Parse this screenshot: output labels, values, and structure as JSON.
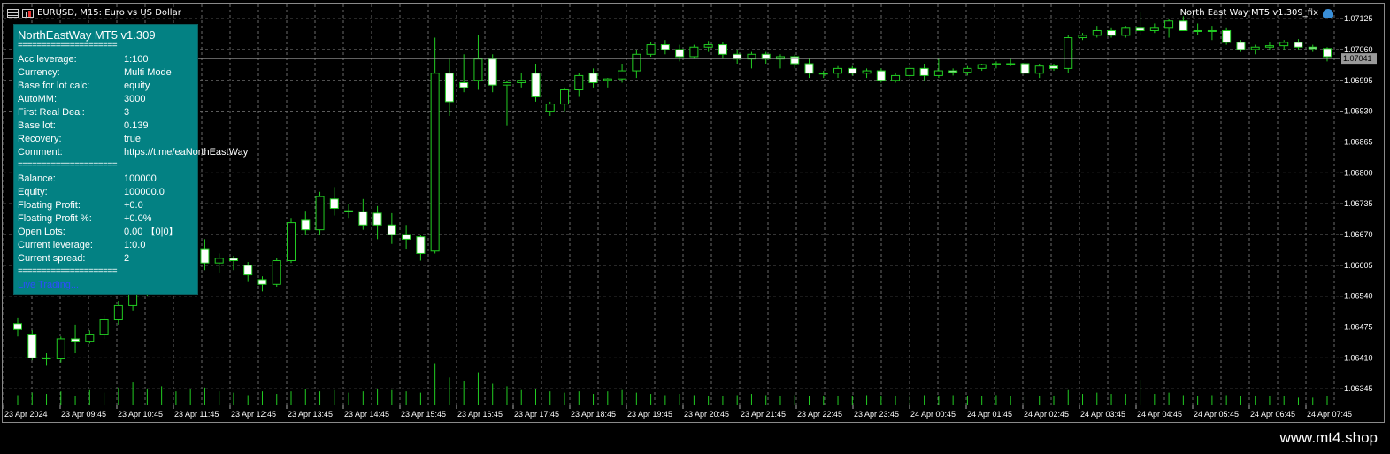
{
  "window": {
    "symbol_title": "EURUSD, M15:  Euro vs US Dollar",
    "ea_title": "North East Way MT5 v1.309_fix"
  },
  "panel": {
    "title": "NorthEastWay MT5 v1.309",
    "separator": "=====================",
    "rows_top": [
      {
        "label": "Acc leverage:",
        "value": "1:100"
      },
      {
        "label": "Currency:",
        "value": "Multi Mode"
      },
      {
        "label": "Base for lot calc:",
        "value": "equity"
      },
      {
        "label": "AutoMM:",
        "value": "3000"
      },
      {
        "label": "First Real Deal:",
        "value": "3"
      },
      {
        "label": "Base lot:",
        "value": "0.139"
      },
      {
        "label": "Recovery:",
        "value": "true"
      },
      {
        "label": "Comment:",
        "value": "https://t.me/eaNorthEastWay"
      }
    ],
    "rows_bottom": [
      {
        "label": "Balance:",
        "value": "100000"
      },
      {
        "label": "Equity:",
        "value": "100000.0"
      },
      {
        "label": "Floating Profit:",
        "value": "+0.0"
      },
      {
        "label": "Floating Profit %:",
        "value": "+0.0%"
      },
      {
        "label": "Open Lots:",
        "value": "0.00 【0|0】"
      },
      {
        "label": "Current leverage:",
        "value": "1:0.0"
      },
      {
        "label": "Current spread:",
        "value": "2"
      }
    ],
    "link": "Live Trading..."
  },
  "price_axis": [
    "1.07125",
    "1.06995",
    "1.06930",
    "1.06865",
    "1.06800",
    "1.06735",
    "1.06670",
    "1.06605",
    "1.06540",
    "1.06475",
    "1.06410",
    "1.06345"
  ],
  "price_axis_top": "1.07060",
  "current_price": "1.07041",
  "time_axis": [
    "23 Apr 2024",
    "23 Apr 09:45",
    "23 Apr 10:45",
    "23 Apr 11:45",
    "23 Apr 12:45",
    "23 Apr 13:45",
    "23 Apr 14:45",
    "23 Apr 15:45",
    "23 Apr 16:45",
    "23 Apr 17:45",
    "23 Apr 18:45",
    "23 Apr 19:45",
    "23 Apr 20:45",
    "23 Apr 21:45",
    "23 Apr 22:45",
    "23 Apr 23:45",
    "24 Apr 00:45",
    "24 Apr 01:45",
    "24 Apr 02:45",
    "24 Apr 03:45",
    "24 Apr 04:45",
    "24 Apr 05:45",
    "24 Apr 06:45",
    "24 Apr 07:45"
  ],
  "watermark": "www.mt4.shop",
  "colors": {
    "bull": "#000000",
    "bear": "#ffffff",
    "wick": "#22cc22",
    "grid": "#6a6a6a",
    "panel": "#038183",
    "volume": "#22cc22"
  },
  "chart_data": {
    "type": "candlestick",
    "ylim": [
      1.0631,
      1.07155
    ],
    "candles": [
      [
        1.06482,
        1.06495,
        1.06455,
        1.0647
      ],
      [
        1.0646,
        1.06468,
        1.06405,
        1.0641
      ],
      [
        1.0641,
        1.0642,
        1.06395,
        1.06408
      ],
      [
        1.06408,
        1.06455,
        1.064,
        1.0645
      ],
      [
        1.0645,
        1.0648,
        1.0642,
        1.06445
      ],
      [
        1.06445,
        1.06468,
        1.0644,
        1.0646
      ],
      [
        1.0646,
        1.065,
        1.0645,
        1.0649
      ],
      [
        1.0649,
        1.0653,
        1.0648,
        1.0652
      ],
      [
        1.0652,
        1.0656,
        1.0651,
        1.06548
      ],
      [
        1.06548,
        1.0659,
        1.0654,
        1.0658
      ],
      [
        1.0658,
        1.0662,
        1.0657,
        1.0661
      ],
      [
        1.0661,
        1.0664,
        1.066,
        1.06625
      ],
      [
        1.06625,
        1.0665,
        1.0661,
        1.0664
      ],
      [
        1.0664,
        1.0666,
        1.06595,
        1.0661
      ],
      [
        1.0661,
        1.0663,
        1.0659,
        1.0662
      ],
      [
        1.0662,
        1.06625,
        1.06595,
        1.06615
      ],
      [
        1.06605,
        1.06612,
        1.0657,
        1.06585
      ],
      [
        1.06575,
        1.06582,
        1.0655,
        1.06565
      ],
      [
        1.06565,
        1.0662,
        1.0656,
        1.06615
      ],
      [
        1.06615,
        1.06705,
        1.0661,
        1.06695
      ],
      [
        1.067,
        1.0672,
        1.0667,
        1.0668
      ],
      [
        1.0668,
        1.0676,
        1.0667,
        1.0675
      ],
      [
        1.06745,
        1.0677,
        1.0671,
        1.06725
      ],
      [
        1.0672,
        1.06735,
        1.06705,
        1.06718
      ],
      [
        1.06718,
        1.06745,
        1.0668,
        1.0669
      ],
      [
        1.06715,
        1.0673,
        1.0666,
        1.0669
      ],
      [
        1.0669,
        1.06715,
        1.0665,
        1.0667
      ],
      [
        1.0667,
        1.0669,
        1.0664,
        1.0666
      ],
      [
        1.06665,
        1.0667,
        1.06615,
        1.0663
      ],
      [
        1.06635,
        1.07085,
        1.0663,
        1.0701
      ],
      [
        1.0701,
        1.0704,
        1.0692,
        1.0695
      ],
      [
        1.0699,
        1.0705,
        1.0697,
        1.0698
      ],
      [
        1.06995,
        1.0709,
        1.06975,
        1.0704
      ],
      [
        1.0704,
        1.0705,
        1.0697,
        1.06985
      ],
      [
        1.06985,
        1.06995,
        1.069,
        1.0699
      ],
      [
        1.0699,
        1.0701,
        1.0698,
        1.06995
      ],
      [
        1.0701,
        1.0703,
        1.0695,
        1.0696
      ],
      [
        1.0693,
        1.0695,
        1.0692,
        1.06945
      ],
      [
        1.06945,
        1.0698,
        1.0693,
        1.06975
      ],
      [
        1.06975,
        1.0701,
        1.0696,
        1.07005
      ],
      [
        1.0701,
        1.0702,
        1.0698,
        1.0699
      ],
      [
        1.06995,
        1.07,
        1.0698,
        1.06998
      ],
      [
        1.06998,
        1.0703,
        1.0699,
        1.07015
      ],
      [
        1.07015,
        1.0706,
        1.07,
        1.0705
      ],
      [
        1.0705,
        1.07075,
        1.07045,
        1.0707
      ],
      [
        1.0707,
        1.0708,
        1.0705,
        1.0706
      ],
      [
        1.0706,
        1.0707,
        1.07035,
        1.07045
      ],
      [
        1.07045,
        1.0707,
        1.0704,
        1.07065
      ],
      [
        1.07065,
        1.07078,
        1.07055,
        1.0707
      ],
      [
        1.0707,
        1.07075,
        1.0704,
        1.0705
      ],
      [
        1.0705,
        1.0706,
        1.0703,
        1.0704
      ],
      [
        1.0704,
        1.07055,
        1.0702,
        1.0705
      ],
      [
        1.0705,
        1.07055,
        1.0703,
        1.0704
      ],
      [
        1.0704,
        1.0705,
        1.0702,
        1.07045
      ],
      [
        1.07045,
        1.0705,
        1.0702,
        1.0703
      ],
      [
        1.0703,
        1.0704,
        1.07,
        1.0701
      ],
      [
        1.0701,
        1.07015,
        1.07,
        1.0701
      ],
      [
        1.0701,
        1.07025,
        1.07,
        1.0702
      ],
      [
        1.0702,
        1.07025,
        1.07005,
        1.0701
      ],
      [
        1.0701,
        1.0702,
        1.07,
        1.07015
      ],
      [
        1.07015,
        1.0702,
        1.0699,
        1.06995
      ],
      [
        1.06995,
        1.0701,
        1.0699,
        1.07005
      ],
      [
        1.07005,
        1.07025,
        1.07,
        1.0702
      ],
      [
        1.0702,
        1.0703,
        1.06995,
        1.07005
      ],
      [
        1.07005,
        1.0704,
        1.07,
        1.07015
      ],
      [
        1.07015,
        1.0702,
        1.07005,
        1.07012
      ],
      [
        1.07012,
        1.07025,
        1.07005,
        1.0702
      ],
      [
        1.0702,
        1.0703,
        1.07015,
        1.07028
      ],
      [
        1.07028,
        1.07035,
        1.0702,
        1.0703
      ],
      [
        1.0703,
        1.0704,
        1.07025,
        1.0703
      ],
      [
        1.0703,
        1.07035,
        1.07005,
        1.0701
      ],
      [
        1.0701,
        1.0703,
        1.07,
        1.07025
      ],
      [
        1.07025,
        1.0703,
        1.07015,
        1.0702
      ],
      [
        1.0702,
        1.0709,
        1.0701,
        1.07085
      ],
      [
        1.07085,
        1.07095,
        1.0708,
        1.0709
      ],
      [
        1.0709,
        1.0711,
        1.07085,
        1.071
      ],
      [
        1.071,
        1.07105,
        1.07085,
        1.0709
      ],
      [
        1.0709,
        1.0711,
        1.07085,
        1.07105
      ],
      [
        1.07105,
        1.0714,
        1.0709,
        1.071
      ],
      [
        1.071,
        1.07115,
        1.07095,
        1.07105
      ],
      [
        1.07105,
        1.07125,
        1.07085,
        1.0712
      ],
      [
        1.0712,
        1.0713,
        1.071,
        1.071
      ],
      [
        1.071,
        1.07115,
        1.0709,
        1.071
      ],
      [
        1.071,
        1.0711,
        1.0708,
        1.071
      ],
      [
        1.071,
        1.07105,
        1.0707,
        1.07075
      ],
      [
        1.07075,
        1.0708,
        1.07055,
        1.0706
      ],
      [
        1.0706,
        1.0707,
        1.0705,
        1.07065
      ],
      [
        1.07065,
        1.07075,
        1.0706,
        1.07068
      ],
      [
        1.07068,
        1.0708,
        1.0706,
        1.07075
      ],
      [
        1.07075,
        1.07082,
        1.0706,
        1.07065
      ],
      [
        1.07065,
        1.0707,
        1.07055,
        1.07062
      ],
      [
        1.07062,
        1.07065,
        1.07035,
        1.07045
      ]
    ],
    "volume": [
      16,
      20,
      18,
      22,
      14,
      24,
      20,
      28,
      36,
      26,
      30,
      22,
      26,
      28,
      22,
      20,
      16,
      22,
      18,
      22,
      26,
      22,
      24,
      20,
      22,
      26,
      24,
      22,
      20,
      66,
      44,
      38,
      52,
      34,
      30,
      24,
      26,
      22,
      20,
      22,
      18,
      22,
      24,
      20,
      18,
      16,
      18,
      16,
      14,
      14,
      16,
      18,
      16,
      14,
      16,
      14,
      14,
      14,
      14,
      16,
      14,
      14,
      14,
      16,
      14,
      16,
      14,
      14,
      16,
      14,
      14,
      14,
      14,
      24,
      18,
      20,
      18,
      18,
      40,
      18,
      20,
      16,
      14,
      16,
      16,
      14,
      14,
      14,
      14,
      12,
      12,
      14
    ]
  }
}
